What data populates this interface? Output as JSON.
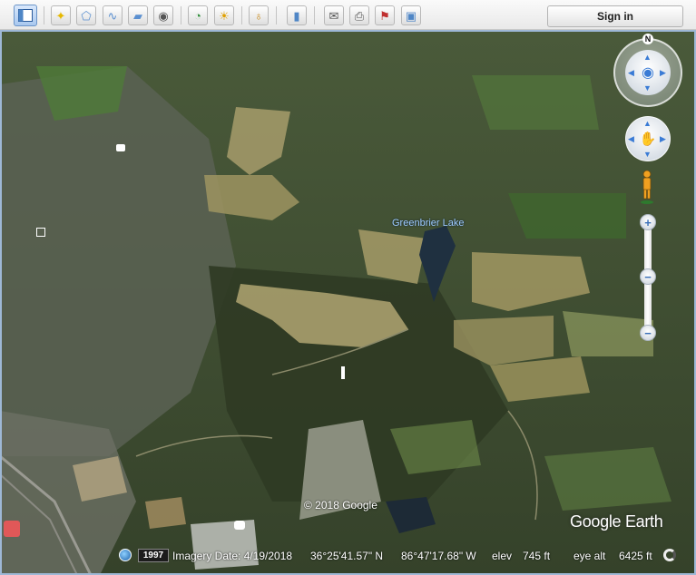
{
  "app": {
    "name": "Google Earth"
  },
  "toolbar": {
    "buttons": [
      {
        "name": "sidebar-toggle",
        "icon": "sidebar-icon",
        "active": true
      },
      {
        "name": "add-placemark",
        "icon": "placemark-icon"
      },
      {
        "name": "add-polygon",
        "icon": "polygon-icon"
      },
      {
        "name": "add-path",
        "icon": "path-icon"
      },
      {
        "name": "add-overlay",
        "icon": "image-overlay-icon"
      },
      {
        "name": "record-tour",
        "icon": "record-tour-icon"
      },
      {
        "name": "historical-imagery",
        "icon": "clock-icon"
      },
      {
        "name": "sunlight",
        "icon": "sun-icon"
      },
      {
        "name": "switch-planet",
        "icon": "planet-icon"
      },
      {
        "name": "ruler",
        "icon": "ruler-icon"
      },
      {
        "name": "email",
        "icon": "envelope-icon"
      },
      {
        "name": "print",
        "icon": "printer-icon"
      },
      {
        "name": "view-in-maps",
        "icon": "maps-icon"
      },
      {
        "name": "save-image",
        "icon": "save-image-icon"
      }
    ],
    "signin_label": "Sign in"
  },
  "map": {
    "lake_label": "Greenbrier Lake",
    "copyright": "© 2018 Google",
    "logo": "Google Earth",
    "compass_letter": "N"
  },
  "status": {
    "year": "1997",
    "imagery_date": "Imagery Date: 4/19/2018",
    "latitude": "36°25'41.57\" N",
    "longitude": "86°47'17.68\" W",
    "elev_label": "elev",
    "elev_value": "745 ft",
    "eye_alt_label": "eye alt",
    "eye_alt_value": "6425 ft"
  },
  "colors": {
    "accent": "#3a7bd5",
    "lake_label": "#9ecbff"
  }
}
